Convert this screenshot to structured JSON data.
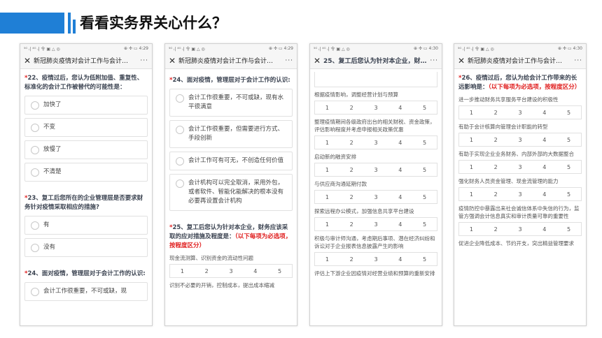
{
  "header": {
    "title": "看看实务界关心什么？"
  },
  "status": {
    "left": "⁵ᴳ ᵢ| ⁴ᴳ ᵢ| 令 ▣ △ ◎",
    "right": "⊕ ✣ ▭"
  },
  "scale_values": [
    "1",
    "2",
    "3",
    "4",
    "5"
  ],
  "phones": [
    {
      "time": "4:29",
      "nav_title": "新冠肺炎疫情对会计工作与会计…",
      "q22": "22、疫情过后，您认为低附加值、重复性、标准化的会计工作被替代的可能性是：",
      "q22_opts": [
        "加快了",
        "不变",
        "放慢了",
        "不清楚"
      ],
      "q23": "23、复工后您所在的企业管理层是否要求财务针对疫情采取相应的措施?",
      "q23_opts": [
        "有",
        "没有"
      ],
      "q24": "24、面对疫情，管理层对于会计工作的认识:",
      "q24_opts": [
        "会计工作很重要，不可或缺，现"
      ]
    },
    {
      "time": "4:29",
      "nav_title": "新冠肺炎疫情对会计工作与会计…",
      "q24": "24、面对疫情，管理层对于会计工作的认识:",
      "q24_opts": [
        "会计工作很重要，不可或缺，现有水平很满意",
        "会计工作很重要，但需要进行方式、手段创新",
        "会计工作可有可无，不创造任何价值",
        "会计机构可以完全取消，采用外包，或者软件、智能化能解决的根本没有必要再设置会计机构"
      ],
      "q25_a": "25、复工后您认为针对本企业，财务应该采取的应对措施及程度是：",
      "q25_b": "（以下每项为必选项，按程度区分）",
      "item1": "现金流测算、识别资金的流动性问题",
      "item2": "识别不必要的开销，控制成本，提出成本缩减"
    },
    {
      "time": "4:30",
      "nav_title": "25、复工后您认为针对本企业，财务…",
      "items": [
        "根据疫情影响，调整经营计划与预算",
        "整理疫情期间各级政府出台的相关财税、资金政策，评估影响程度并考虑申报相关政策优惠",
        "启动新的融资安排",
        "与供应商沟通延期付款",
        "探索远程办公模式，加强信息共享平台建设",
        "积极与审计师沟通，考虑期后事项、潜在经济纠纷和诉讼对于企业报表信息披露产生的影响",
        "评估上下游企业因疫情对经营业绩和预算的重新安排"
      ]
    },
    {
      "time": "4:30",
      "nav_title": "新冠肺炎疫情对会计工作与会计…",
      "q26_a": "26、疫情过后，您认为给会计工作带来的长远影响是：",
      "q26_b": "（以下每项为必选项，按程度区分）",
      "items": [
        "进一步推动财务共享服务平台建设的积极性",
        "有助于会计核算向管理会计职能的转型",
        "有助于实现企业业务财务、内部外部的大数据整合",
        "强化财务人员资金管理、现金流管理的能力",
        "疫情防控中暴露出来社会诚信体系中失信的行为，监管方强调会计信息真实和审计质量可靠的重要性",
        "促进企业降低成本、节约开支，突出精益管理要求"
      ]
    }
  ]
}
